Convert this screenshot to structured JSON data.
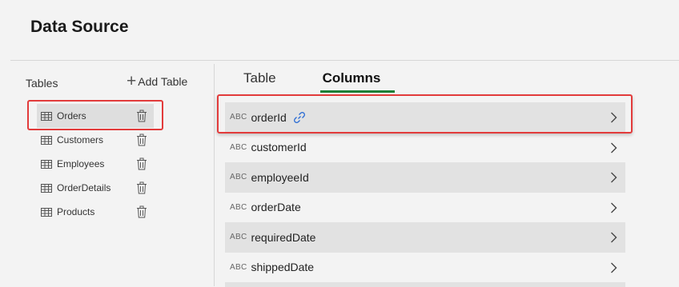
{
  "header": {
    "title": "Data Source"
  },
  "tables_panel": {
    "label": "Tables",
    "add_label": "Add Table",
    "items": [
      {
        "name": "Orders",
        "selected": true
      },
      {
        "name": "Customers",
        "selected": false
      },
      {
        "name": "Employees",
        "selected": false
      },
      {
        "name": "OrderDetails",
        "selected": false
      },
      {
        "name": "Products",
        "selected": false
      }
    ]
  },
  "tabs": [
    {
      "label": "Table",
      "active": false
    },
    {
      "label": "Columns",
      "active": true
    }
  ],
  "columns": [
    {
      "type": "ABC",
      "name": "orderId",
      "key": true
    },
    {
      "type": "ABC",
      "name": "customerId"
    },
    {
      "type": "ABC",
      "name": "employeeId"
    },
    {
      "type": "ABC",
      "name": "orderDate"
    },
    {
      "type": "ABC",
      "name": "requiredDate"
    },
    {
      "type": "ABC",
      "name": "shippedDate"
    }
  ],
  "colors": {
    "highlight": "#e23b3b",
    "active_tab_underline": "#1a7f37",
    "link_icon": "#2b6cd4"
  }
}
